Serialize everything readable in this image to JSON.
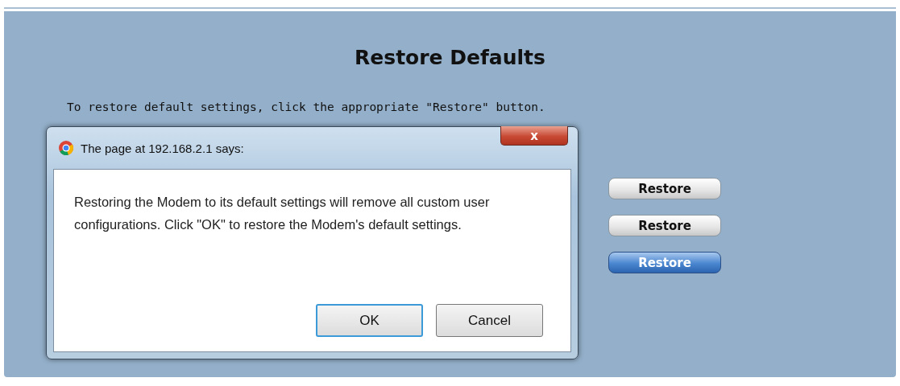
{
  "page": {
    "title": "Restore Defaults",
    "instruction": "To restore default settings, click the appropriate \"Restore\" button.",
    "restore_buttons": [
      {
        "label": "Restore",
        "selected": false
      },
      {
        "label": "Restore",
        "selected": false
      },
      {
        "label": "Restore",
        "selected": true
      }
    ]
  },
  "dialog": {
    "title": "The page at 192.168.2.1 says:",
    "close": "x",
    "message": "Restoring the Modem to its default settings will remove all custom user configurations. Click \"OK\" to restore the Modem's default settings.",
    "buttons": [
      {
        "label": "OK",
        "selected": true
      },
      {
        "label": "Cancel",
        "selected": false
      }
    ]
  }
}
